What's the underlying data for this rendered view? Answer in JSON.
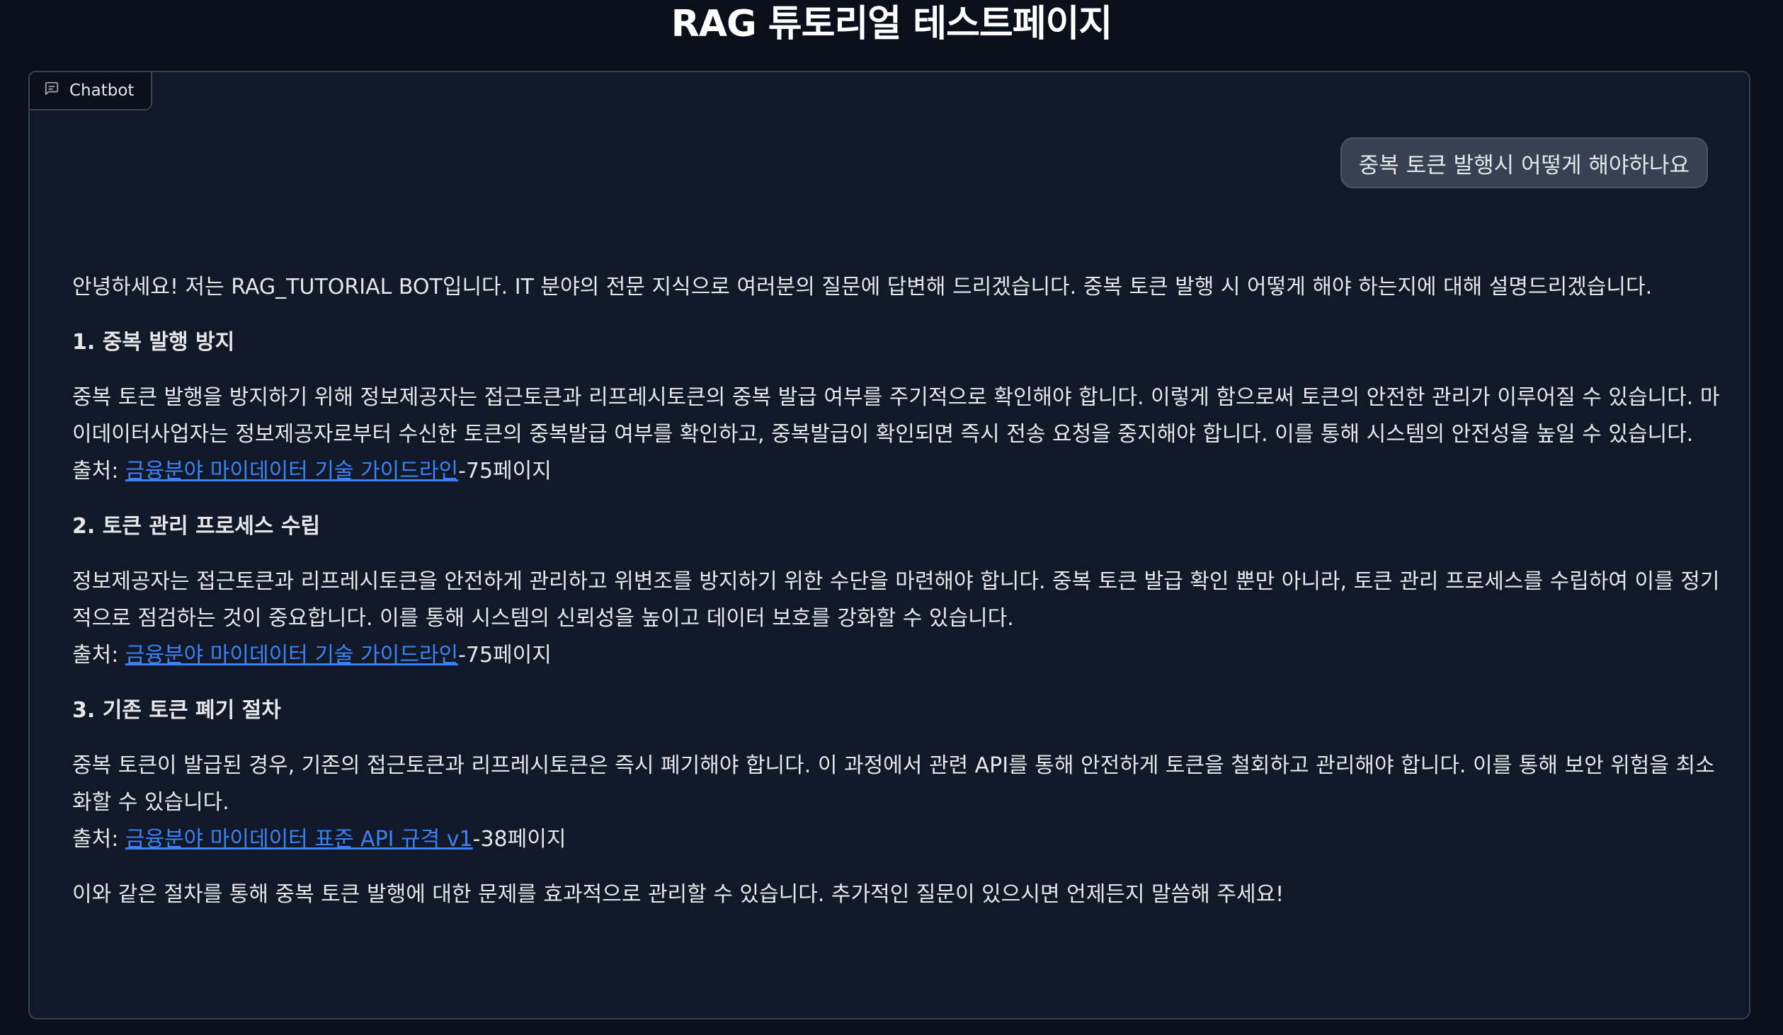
{
  "page": {
    "title": "RAG 튜토리얼 테스트페이지"
  },
  "chatbot": {
    "label": "Chatbot",
    "user_message": "중복 토큰 발행시 어떻게 해야하나요",
    "intro": "안녕하세요! 저는 RAG_TUTORIAL BOT입니다. IT 분야의 전문 지식으로 여러분의 질문에 답변해 드리겠습니다. 중복 토큰 발행 시 어떻게 해야 하는지에 대해 설명드리겠습니다.",
    "sections": [
      {
        "heading": "1. 중복 발행 방지",
        "body": "중복 토큰 발행을 방지하기 위해 정보제공자는 접근토큰과 리프레시토큰의 중복 발급 여부를 주기적으로 확인해야 합니다. 이렇게 함으로써 토큰의 안전한 관리가 이루어질 수 있습니다. 마이데이터사업자는 정보제공자로부터 수신한 토큰의 중복발급 여부를 확인하고, 중복발급이 확인되면 즉시 전송 요청을 중지해야 합니다. 이를 통해 시스템의 안전성을 높일 수 있습니다.",
        "source_prefix": "출처: ",
        "source_link": "금융분야 마이데이터 기술 가이드라인",
        "source_suffix": "-75페이지"
      },
      {
        "heading": "2. 토큰 관리 프로세스 수립",
        "body": "정보제공자는 접근토큰과 리프레시토큰을 안전하게 관리하고 위변조를 방지하기 위한 수단을 마련해야 합니다. 중복 토큰 발급 확인 뿐만 아니라, 토큰 관리 프로세스를 수립하여 이를 정기적으로 점검하는 것이 중요합니다. 이를 통해 시스템의 신뢰성을 높이고 데이터 보호를 강화할 수 있습니다.",
        "source_prefix": "출처: ",
        "source_link": "금융분야 마이데이터 기술 가이드라인",
        "source_suffix": "-75페이지"
      },
      {
        "heading": "3. 기존 토큰 폐기 절차",
        "body": "중복 토큰이 발급된 경우, 기존의 접근토큰과 리프레시토큰은 즉시 폐기해야 합니다. 이 과정에서 관련 API를 통해 안전하게 토큰을 철회하고 관리해야 합니다. 이를 통해 보안 위험을 최소화할 수 있습니다.",
        "source_prefix": "출처: ",
        "source_link": "금융분야 마이데이터 표준 API 규격 v1",
        "source_suffix": "-38페이지"
      }
    ],
    "closing": "이와 같은 절차를 통해 중복 토큰 발행에 대한 문제를 효과적으로 관리할 수 있습니다. 추가적인 질문이 있으시면 언제든지 말씀해 주세요!"
  },
  "icons": {
    "chatbot_label_icon": "chat-bubble-icon"
  },
  "colors": {
    "background": "#0b0f19",
    "panel": "#111827",
    "link": "#3b82f6",
    "user_bubble": "#374151"
  }
}
